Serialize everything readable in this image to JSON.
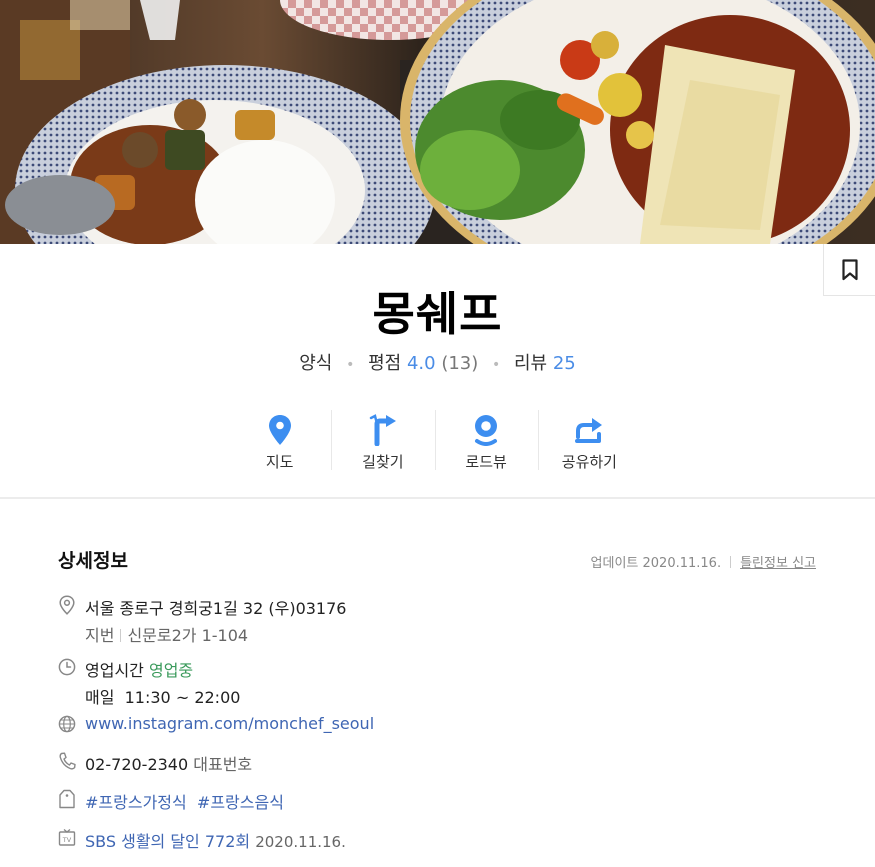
{
  "place": {
    "name": "몽쉐프",
    "category": "양식",
    "rating_label": "평점",
    "rating": "4.0",
    "rating_count": "(13)",
    "review_label": "리뷰",
    "review_count": "25"
  },
  "actions": [
    {
      "label": "지도",
      "icon": "map-pin-icon"
    },
    {
      "label": "길찾기",
      "icon": "directions-icon"
    },
    {
      "label": "로드뷰",
      "icon": "roadview-icon"
    },
    {
      "label": "공유하기",
      "icon": "share-icon"
    }
  ],
  "details": {
    "title": "상세정보",
    "updated_label": "업데이트 2020.11.16.",
    "report_link": "틀린정보 신고",
    "address": "서울 종로구 경희궁1길 32 (우)03176",
    "lot_label": "지번",
    "lot_address": "신문로2가 1-104",
    "hours_label": "영업시간",
    "hours_status": "영업중",
    "hours_days": "매일",
    "hours_time": "11:30 ~ 22:00",
    "website": "www.instagram.com/monchef_seoul",
    "phone": "02-720-2340",
    "phone_label": "대표번호",
    "tags": [
      "#프랑스가정식",
      "#프랑스음식"
    ],
    "tv_program": "SBS 생활의 달인 772회",
    "tv_date": "2020.11.16."
  },
  "colors": {
    "accent": "#3d8ef0",
    "link": "#3f66b3",
    "open_status": "#3a9a5b"
  }
}
